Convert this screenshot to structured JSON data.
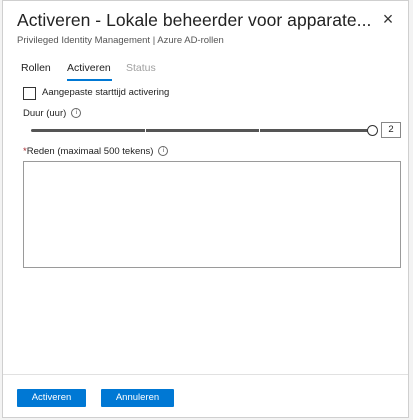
{
  "panel": {
    "title": "Activeren - Lokale beheerder voor apparate...",
    "subtitle": "Privileged Identity Management | Azure AD-rollen",
    "close_icon": "×"
  },
  "tabs": [
    {
      "label": "Rollen",
      "active": false,
      "disabled": false
    },
    {
      "label": "Activeren",
      "active": true,
      "disabled": false
    },
    {
      "label": "Status",
      "active": false,
      "disabled": true
    }
  ],
  "custom_start": {
    "label": "Aangepaste starttijd activering",
    "checked": false
  },
  "duration": {
    "label": "Duur (uur)",
    "value": "2",
    "level": 1.0
  },
  "reason": {
    "required_marker": "*",
    "label": "Reden (maximaal 500 tekens)",
    "value": ""
  },
  "info_icon": "i",
  "buttons": {
    "activate": "Activeren",
    "cancel": "Annuleren"
  },
  "colors": {
    "accent": "#0078d4",
    "required": "#a4262c"
  }
}
